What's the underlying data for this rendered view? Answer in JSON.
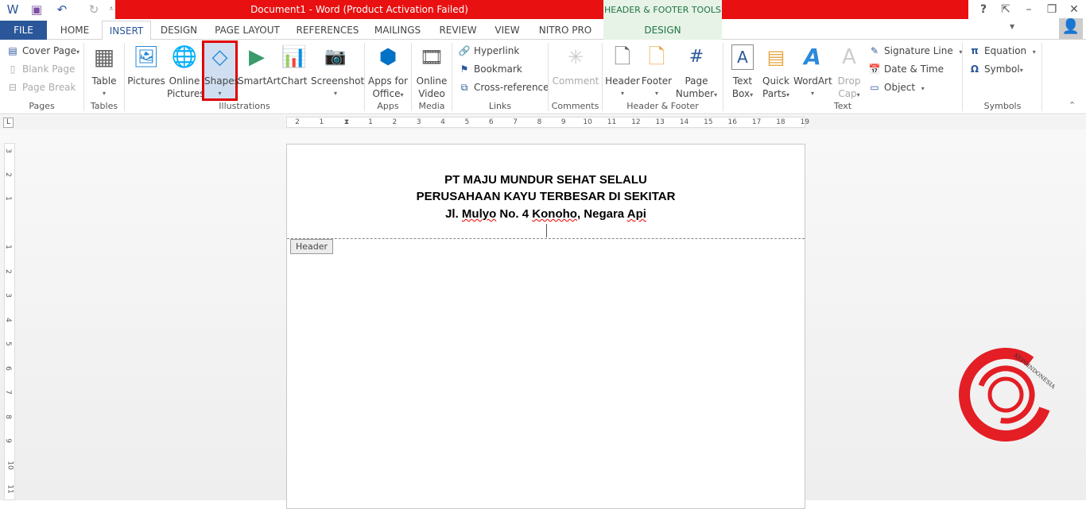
{
  "title_bar": {
    "title": "Document1 -  Word (Product Activation Failed)",
    "context_header": "HEADER & FOOTER TOOLS",
    "help": "?",
    "window_controls": [
      "ribbon-display-icon",
      "minimize-icon",
      "restore-icon",
      "close-icon"
    ]
  },
  "tabs": [
    "FILE",
    "HOME",
    "INSERT",
    "DESIGN",
    "PAGE LAYOUT",
    "REFERENCES",
    "MAILINGS",
    "REVIEW",
    "VIEW",
    "NITRO PRO",
    "DESIGN"
  ],
  "active_tab": "INSERT",
  "ribbon": {
    "pages": {
      "label": "Pages",
      "items": [
        "Cover Page",
        "Blank Page",
        "Page Break"
      ]
    },
    "tables": {
      "label": "Tables",
      "table": "Table"
    },
    "illustrations": {
      "label": "Illustrations",
      "pictures": "Pictures",
      "online_pictures": [
        "Online",
        "Pictures"
      ],
      "shapes": "Shapes",
      "smartart": "SmartArt",
      "chart": "Chart",
      "screenshot": "Screenshot"
    },
    "apps": {
      "label": "Apps",
      "apps_for_office": [
        "Apps for",
        "Office"
      ]
    },
    "media": {
      "label": "Media",
      "online_video": [
        "Online",
        "Video"
      ]
    },
    "links": {
      "label": "Links",
      "items": [
        "Hyperlink",
        "Bookmark",
        "Cross-reference"
      ]
    },
    "comments": {
      "label": "Comments",
      "comment": "Comment"
    },
    "header_footer": {
      "label": "Header & Footer",
      "header": "Header",
      "footer": "Footer",
      "page_number": [
        "Page",
        "Number"
      ]
    },
    "text": {
      "label": "Text",
      "text_box": [
        "Text",
        "Box"
      ],
      "quick_parts": [
        "Quick",
        "Parts"
      ],
      "wordart": "WordArt",
      "drop_cap": [
        "Drop",
        "Cap"
      ],
      "items": [
        "Signature Line",
        "Date & Time",
        "Object"
      ]
    },
    "symbols": {
      "label": "Symbols",
      "equation": "Equation",
      "symbol": "Symbol"
    }
  },
  "highlight_color": "#e00000",
  "ruler": {
    "left": [
      "2",
      "1"
    ],
    "right": [
      "1",
      "2",
      "3",
      "4",
      "5",
      "6",
      "7",
      "8",
      "9",
      "10",
      "11",
      "12",
      "13",
      "14",
      "15",
      "16",
      "17",
      "18",
      "19"
    ],
    "vertical_top": [
      "3",
      "2",
      "1"
    ],
    "vertical_bottom": [
      "1",
      "2",
      "3",
      "4",
      "5",
      "6",
      "7",
      "8",
      "9",
      "10",
      "11"
    ]
  },
  "document": {
    "header_lines": [
      "PT MAJU MUNDUR SEHAT SELALU",
      "PERUSAHAAN KAYU TERBESAR DI SEKITAR"
    ],
    "line3": {
      "a": "Jl. ",
      "b": "Mulyo",
      "c": " No. 4 ",
      "d": "Konoho",
      "e": ", Negara ",
      "f": "Api"
    },
    "header_tag": "Header"
  },
  "watermark": {
    "text": "KEPOINDONESIA",
    "color": "#e31e24"
  }
}
